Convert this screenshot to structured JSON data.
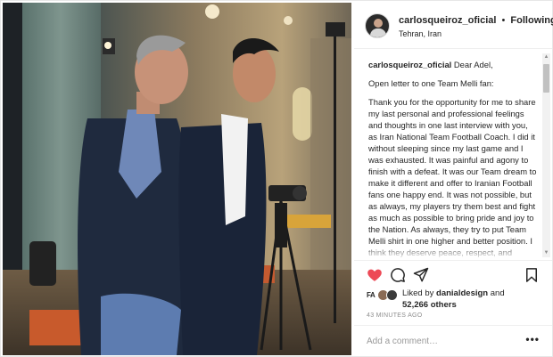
{
  "header": {
    "username": "carlosqueiroz_oficial",
    "separator": "•",
    "follow_status": "Following",
    "location": "Tehran, Iran"
  },
  "caption": {
    "username": "carlosqueiroz_oficial",
    "greeting": "Dear Adel,",
    "title": "Open letter to one Team Melli fan:",
    "body": "Thank you for the opportunity for me to share my last personal and professional feelings and thoughts in one last interview with you, as Iran National Team Football Coach. I did it without sleeping since my last game and I was exhausted. It was painful and agony to finish with a defeat. It was our Team dream to make it different and offer to Iranian Football fans one happy end. It was not possible, but as always, my players try them best and fight as much as possible to bring pride and joy to the Nation. As always, they try to put Team Melli shirt in one higher and better position. I think they deserve peace, respect, and appreciation for all they did."
  },
  "likes": {
    "liker_badge": "FA",
    "liked_by_prefix": "Liked by",
    "liked_by_user": "danialdesign",
    "and": "and",
    "count": "52,266 others"
  },
  "time_ago": "43 MINUTES AGO",
  "comment": {
    "placeholder": "Add a comment…",
    "more": "•••"
  },
  "colors": {
    "like_red": "#ed4956",
    "muted": "#8e8e8e"
  },
  "icons": [
    "heart-icon",
    "comment-icon",
    "share-icon",
    "bookmark-icon"
  ]
}
